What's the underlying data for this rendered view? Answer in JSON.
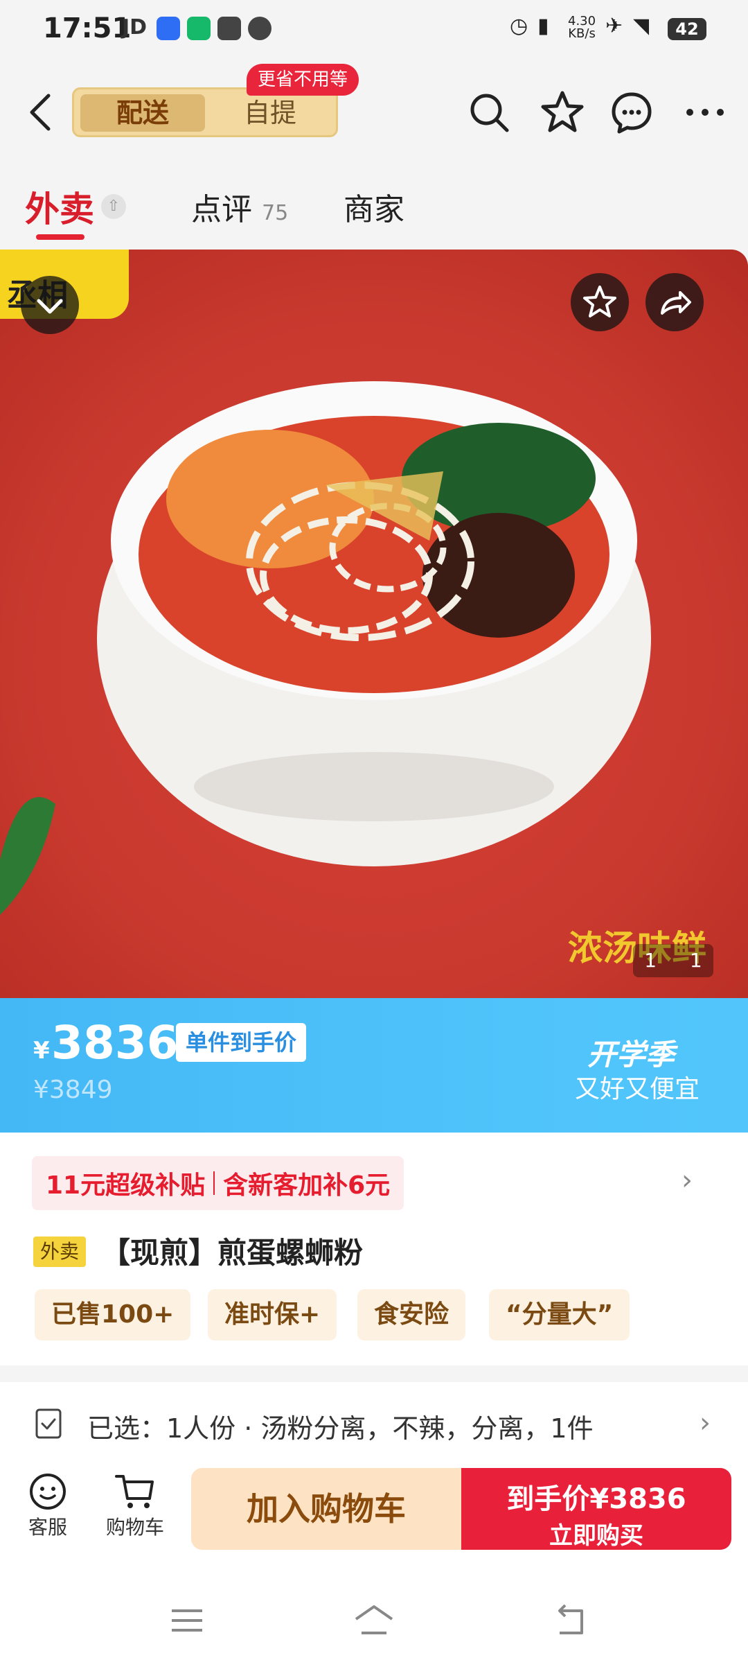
{
  "status_bar": {
    "time": "17:51",
    "carrier_label": "JD",
    "net_speed_value": "4.30",
    "net_speed_unit": "KB/s",
    "battery": "42"
  },
  "header": {
    "segment_active": "配送",
    "segment_inactive": "自提",
    "segment_badge": "更省不用等"
  },
  "tabs": [
    {
      "label": "外卖",
      "active": true
    },
    {
      "label": "点评",
      "count": "75",
      "active": false
    },
    {
      "label": "商家",
      "active": false
    }
  ],
  "hero": {
    "logo_text": "丞相",
    "slogan": "浓汤味鲜",
    "counter_current": "1",
    "counter_total": "1"
  },
  "price": {
    "currency": "¥",
    "amount": "3836",
    "tag": "单件到手价",
    "original": "¥3849",
    "promo_title": "开学季",
    "promo_subtitle": "又好又便宜"
  },
  "detail": {
    "subsidy_1": "11元超级补贴",
    "subsidy_2": "含新客加补6元",
    "channel_badge": "外卖",
    "title": "【现煎】煎蛋螺蛳粉",
    "tags": [
      "已售100+",
      "准时保+",
      "食安险",
      "“分量大”"
    ]
  },
  "selection": {
    "text": "已选：1人份 · 汤粉分离，不辣，分离，1件"
  },
  "bottom_bar": {
    "service_label": "客服",
    "cart_label": "购物车",
    "add_to_cart": "加入购物车",
    "buy_price": "到手价¥3836",
    "buy_now": "立即购买"
  },
  "colors": {
    "accent_red": "#e8203a",
    "banner_blue": "#4fc4fb",
    "gold": "#dcb873"
  }
}
